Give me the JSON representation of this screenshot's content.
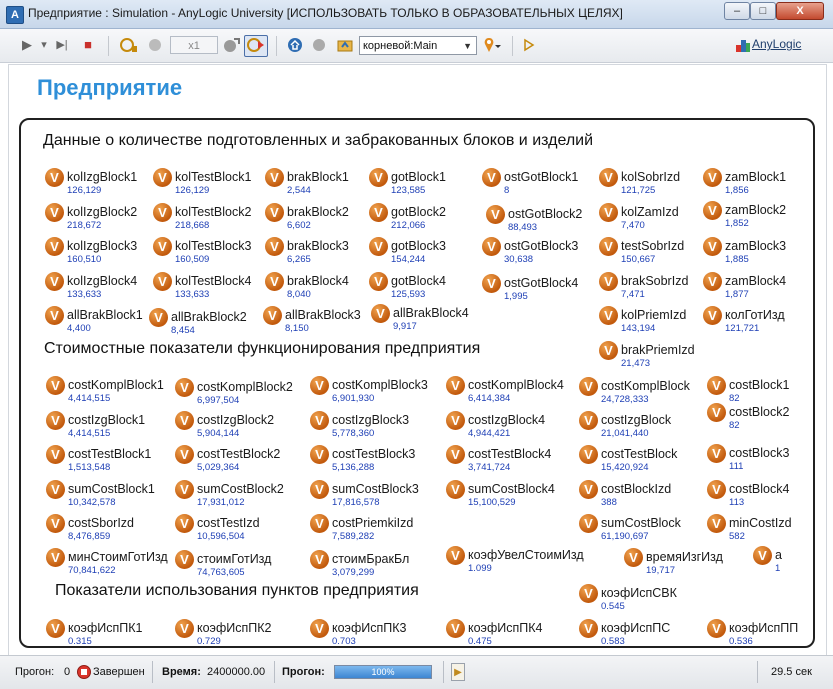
{
  "window": {
    "title": "Предприятие : Simulation - AnyLogic University  [ИСПОЛЬЗОВАТЬ ТОЛЬКО В ОБРАЗОВАТЕЛЬНЫХ ЦЕЛЯХ]",
    "app_icon": "A",
    "min_label": "–",
    "max_label": "□",
    "close_label": "X"
  },
  "toolbar": {
    "run_icon": "▶",
    "run_menu_icon": "▾",
    "step_icon": "▶|",
    "stop_icon": "■",
    "speed": "x1",
    "agent_select": "корневой:Main",
    "logo": "AnyLogic"
  },
  "page": {
    "title": "Предприятие"
  },
  "sections": {
    "s1": "Данные о количестве подготовленных и забракованных блоков и изделий",
    "s2": "Стоимостные показатели функционирования предприятия",
    "s3": "Показатели использования пунктов предприятия"
  },
  "icon_letter": "V",
  "variables": [
    {
      "name": "kolIzgBlock1",
      "value": "126,129"
    },
    {
      "name": "kolTestBlock1",
      "value": "126,129"
    },
    {
      "name": "brakBlock1",
      "value": "2,544"
    },
    {
      "name": "gotBlock1",
      "value": "123,585"
    },
    {
      "name": "ostGotBlock1",
      "value": "8"
    },
    {
      "name": "kolSobrIzd",
      "value": "121,725"
    },
    {
      "name": "zamBlock1",
      "value": "1,856"
    },
    {
      "name": "kolIzgBlock2",
      "value": "218,672"
    },
    {
      "name": "kolTestBlock2",
      "value": "218,668"
    },
    {
      "name": "brakBlock2",
      "value": "6,602"
    },
    {
      "name": "gotBlock2",
      "value": "212,066"
    },
    {
      "name": "ostGotBlock2",
      "value": "88,493"
    },
    {
      "name": "kolZamIzd",
      "value": "7,470"
    },
    {
      "name": "zamBlock2",
      "value": "1,852"
    },
    {
      "name": "kolIzgBlock3",
      "value": "160,510"
    },
    {
      "name": "kolTestBlock3",
      "value": "160,509"
    },
    {
      "name": "brakBlock3",
      "value": "6,265"
    },
    {
      "name": "gotBlock3",
      "value": "154,244"
    },
    {
      "name": "ostGotBlock3",
      "value": "30,638"
    },
    {
      "name": "testSobrIzd",
      "value": "150,667"
    },
    {
      "name": "zamBlock3",
      "value": "1,885"
    },
    {
      "name": "kolIzgBlock4",
      "value": "133,633"
    },
    {
      "name": "kolTestBlock4",
      "value": "133,633"
    },
    {
      "name": "brakBlock4",
      "value": "8,040"
    },
    {
      "name": "gotBlock4",
      "value": "125,593"
    },
    {
      "name": "ostGotBlock4",
      "value": "1,995"
    },
    {
      "name": "brakSobrIzd",
      "value": "7,471"
    },
    {
      "name": "zamBlock4",
      "value": "1,877"
    },
    {
      "name": "allBrakBlock1",
      "value": "4,400"
    },
    {
      "name": "allBrakBlock2",
      "value": "8,454"
    },
    {
      "name": "allBrakBlock3",
      "value": "8,150"
    },
    {
      "name": "allBrakBlock4",
      "value": "9,917"
    },
    {
      "name": "kolPriemIzd",
      "value": "143,194"
    },
    {
      "name": "колГотИзд",
      "value": "121,721"
    },
    {
      "name": "brakPriemIzd",
      "value": "21,473"
    },
    {
      "name": "costKomplBlock1",
      "value": "4,414,515"
    },
    {
      "name": "costKomplBlock2",
      "value": "6,997,504"
    },
    {
      "name": "costKomplBlock3",
      "value": "6,901,930"
    },
    {
      "name": "costKomplBlock4",
      "value": "6,414,384"
    },
    {
      "name": "costKomplBlock",
      "value": "24,728,333"
    },
    {
      "name": "costBlock1",
      "value": "82"
    },
    {
      "name": "costIzgBlock1",
      "value": "4,414,515"
    },
    {
      "name": "costIzgBlock2",
      "value": "5,904,144"
    },
    {
      "name": "costIzgBlock3",
      "value": "5,778,360"
    },
    {
      "name": "costIzgBlock4",
      "value": "4,944,421"
    },
    {
      "name": "costIzgBlock",
      "value": "21,041,440"
    },
    {
      "name": "costBlock2",
      "value": "82"
    },
    {
      "name": "costTestBlock1",
      "value": "1,513,548"
    },
    {
      "name": "costTestBlock2",
      "value": "5,029,364"
    },
    {
      "name": "costTestBlock3",
      "value": "5,136,288"
    },
    {
      "name": "costTestBlock4",
      "value": "3,741,724"
    },
    {
      "name": "costTestBlock",
      "value": "15,420,924"
    },
    {
      "name": "costBlock3",
      "value": "111"
    },
    {
      "name": "sumCostBlock1",
      "value": "10,342,578"
    },
    {
      "name": "sumCostBlock2",
      "value": "17,931,012"
    },
    {
      "name": "sumCostBlock3",
      "value": "17,816,578"
    },
    {
      "name": "sumCostBlock4",
      "value": "15,100,529"
    },
    {
      "name": "costBlockIzd",
      "value": "388"
    },
    {
      "name": "costBlock4",
      "value": "113"
    },
    {
      "name": "costSborIzd",
      "value": "8,476,859"
    },
    {
      "name": "costTestIzd",
      "value": "10,596,504"
    },
    {
      "name": "costPriemkiIzd",
      "value": "7,589,282"
    },
    {
      "name": "sumCostBlock",
      "value": "61,190,697"
    },
    {
      "name": "minCostIzd",
      "value": "582"
    },
    {
      "name": "минСтоимГотИзд",
      "value": "70,841,622"
    },
    {
      "name": "стоимГотИзд",
      "value": "74,763,605"
    },
    {
      "name": "стоимБракБл",
      "value": "3,079,299"
    },
    {
      "name": "коэфУвелСтоимИзд",
      "value": "1.099"
    },
    {
      "name": "времяИзгИзд",
      "value": "19,717"
    },
    {
      "name": "a",
      "value": "1"
    },
    {
      "name": "коэфИспСВК",
      "value": "0.545"
    },
    {
      "name": "коэфИспПК1",
      "value": "0.315"
    },
    {
      "name": "коэфИспПК2",
      "value": "0.729"
    },
    {
      "name": "коэфИспПК3",
      "value": "0.703"
    },
    {
      "name": "коэфИспПК4",
      "value": "0.475"
    },
    {
      "name": "коэфИспПС",
      "value": "0.583"
    },
    {
      "name": "коэфИспПП",
      "value": "0.536"
    }
  ],
  "status": {
    "run_label": "Прогон:",
    "run_number": "0",
    "state": "Завершен",
    "time_label": "Время:",
    "time_value": "2400000.00",
    "progress_label": "Прогон:",
    "progress_text": "100%",
    "progress_fraction": 1.0,
    "elapsed": "29.5 сек"
  }
}
